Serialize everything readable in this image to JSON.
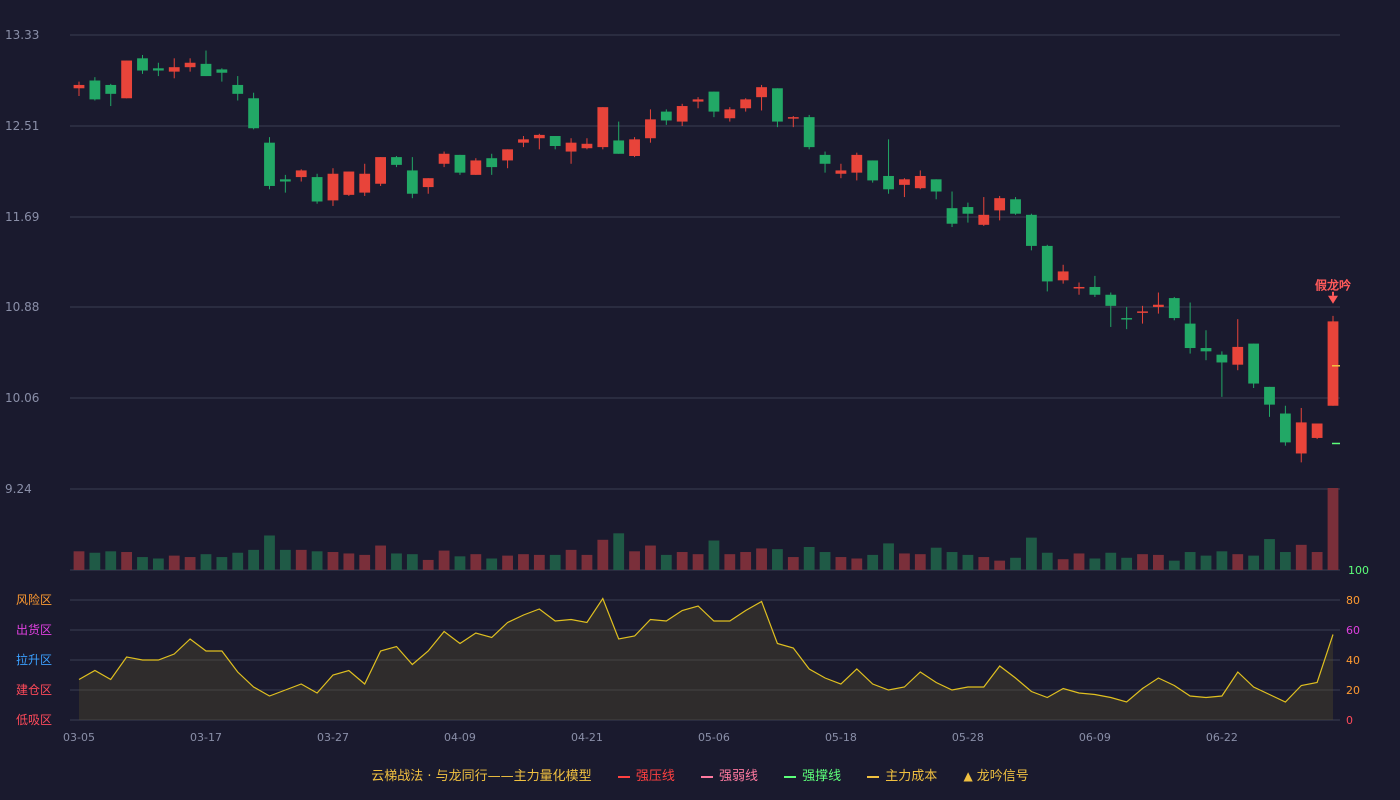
{
  "colors": {
    "background": "#1a1a2e",
    "up": "#e8443a",
    "down": "#22a866",
    "up_volume": "#7a2f3a",
    "down_volume": "#1f5a46",
    "grid": "#3a3d52",
    "axis_text": "#8a8fa8",
    "money_line": "#e0c020",
    "signal": "#ff5a5a"
  },
  "chart_data": [
    {
      "type": "candlestick",
      "title": "",
      "y_ticks": [
        9.24,
        10.06,
        10.88,
        11.69,
        12.51,
        13.33
      ],
      "ylim": [
        9.24,
        13.33
      ],
      "grid": true,
      "annotation": {
        "text": "假龙吟",
        "index": 79,
        "price": 10.9
      },
      "side_markers": [
        {
          "price": 10.35,
          "color": "#f0c040"
        },
        {
          "price": 9.65,
          "color": "#5cff7a"
        }
      ],
      "ohlc": [
        [
          12.85,
          12.88,
          12.78,
          12.91
        ],
        [
          12.92,
          12.75,
          12.74,
          12.95
        ],
        [
          12.88,
          12.8,
          12.69,
          12.89
        ],
        [
          12.76,
          13.1,
          12.76,
          13.1
        ],
        [
          13.12,
          13.01,
          12.98,
          13.15
        ],
        [
          13.03,
          13.01,
          12.96,
          13.08
        ],
        [
          13.0,
          13.04,
          12.94,
          13.12
        ],
        [
          13.04,
          13.08,
          13.0,
          13.12
        ],
        [
          13.07,
          12.96,
          12.96,
          13.19
        ],
        [
          13.02,
          12.99,
          12.91,
          13.03
        ],
        [
          12.88,
          12.8,
          12.74,
          12.96
        ],
        [
          12.76,
          12.49,
          12.48,
          12.81
        ],
        [
          12.36,
          11.97,
          11.94,
          12.41
        ],
        [
          12.03,
          12.01,
          11.91,
          12.07
        ],
        [
          12.05,
          12.11,
          12.01,
          12.12
        ],
        [
          12.05,
          11.83,
          11.81,
          12.08
        ],
        [
          11.84,
          12.08,
          11.79,
          12.13
        ],
        [
          11.89,
          12.1,
          11.88,
          12.1
        ],
        [
          11.91,
          12.08,
          11.88,
          12.17
        ],
        [
          11.99,
          12.23,
          11.97,
          12.23
        ],
        [
          12.23,
          12.16,
          12.14,
          12.24
        ],
        [
          12.11,
          11.9,
          11.86,
          12.23
        ],
        [
          11.96,
          12.04,
          11.9,
          12.04
        ],
        [
          12.17,
          12.26,
          12.14,
          12.28
        ],
        [
          12.25,
          12.09,
          12.07,
          12.25
        ],
        [
          12.07,
          12.2,
          12.07,
          12.22
        ],
        [
          12.22,
          12.14,
          12.07,
          12.26
        ],
        [
          12.2,
          12.3,
          12.13,
          12.3
        ],
        [
          12.36,
          12.39,
          12.32,
          12.42
        ],
        [
          12.4,
          12.43,
          12.3,
          12.44
        ],
        [
          12.42,
          12.33,
          12.3,
          12.42
        ],
        [
          12.28,
          12.36,
          12.17,
          12.4
        ],
        [
          12.31,
          12.35,
          12.3,
          12.4
        ],
        [
          12.32,
          12.68,
          12.3,
          12.68
        ],
        [
          12.38,
          12.26,
          12.26,
          12.55
        ],
        [
          12.24,
          12.39,
          12.23,
          12.41
        ],
        [
          12.4,
          12.57,
          12.36,
          12.66
        ],
        [
          12.64,
          12.56,
          12.52,
          12.66
        ],
        [
          12.55,
          12.69,
          12.51,
          12.71
        ],
        [
          12.73,
          12.75,
          12.67,
          12.77
        ],
        [
          12.82,
          12.64,
          12.59,
          12.82
        ],
        [
          12.58,
          12.66,
          12.55,
          12.68
        ],
        [
          12.67,
          12.75,
          12.64,
          12.76
        ],
        [
          12.77,
          12.86,
          12.65,
          12.88
        ],
        [
          12.85,
          12.55,
          12.5,
          12.85
        ],
        [
          12.59,
          12.59,
          12.5,
          12.6
        ],
        [
          12.59,
          12.32,
          12.3,
          12.61
        ],
        [
          12.25,
          12.17,
          12.09,
          12.28
        ],
        [
          12.08,
          12.11,
          12.04,
          12.17
        ],
        [
          12.09,
          12.25,
          12.02,
          12.27
        ],
        [
          12.2,
          12.02,
          12.0,
          12.2
        ],
        [
          12.06,
          11.94,
          11.9,
          12.39
        ],
        [
          11.98,
          12.03,
          11.87,
          12.04
        ],
        [
          11.95,
          12.06,
          11.94,
          12.11
        ],
        [
          12.03,
          11.92,
          11.85,
          12.03
        ],
        [
          11.77,
          11.63,
          11.6,
          11.92
        ],
        [
          11.78,
          11.72,
          11.64,
          11.82
        ],
        [
          11.62,
          11.71,
          11.61,
          11.87
        ],
        [
          11.75,
          11.86,
          11.66,
          11.88
        ],
        [
          11.85,
          11.72,
          11.71,
          11.87
        ],
        [
          11.71,
          11.43,
          11.39,
          11.72
        ],
        [
          11.43,
          11.11,
          11.02,
          11.44
        ],
        [
          11.12,
          11.2,
          11.09,
          11.26
        ],
        [
          11.06,
          11.06,
          10.99,
          11.1
        ],
        [
          11.06,
          10.99,
          10.97,
          11.16
        ],
        [
          10.99,
          10.89,
          10.7,
          11.01
        ],
        [
          10.78,
          10.77,
          10.68,
          10.88
        ],
        [
          10.83,
          10.84,
          10.73,
          10.89
        ],
        [
          10.88,
          10.9,
          10.82,
          11.01
        ],
        [
          10.96,
          10.78,
          10.76,
          10.97
        ],
        [
          10.73,
          10.51,
          10.46,
          10.92
        ],
        [
          10.51,
          10.48,
          10.4,
          10.67
        ],
        [
          10.45,
          10.38,
          10.07,
          10.48
        ],
        [
          10.36,
          10.52,
          10.31,
          10.77
        ],
        [
          10.55,
          10.19,
          10.15,
          10.55
        ],
        [
          10.16,
          10.0,
          9.89,
          10.16
        ],
        [
          9.92,
          9.66,
          9.63,
          9.99
        ],
        [
          9.56,
          9.84,
          9.48,
          9.97
        ],
        [
          9.7,
          9.83,
          9.69,
          9.82
        ],
        [
          9.99,
          10.75,
          9.99,
          10.8
        ]
      ],
      "volume": [
        26,
        24,
        26,
        25,
        18,
        16,
        20,
        18,
        22,
        18,
        24,
        28,
        48,
        28,
        28,
        26,
        25,
        23,
        21,
        34,
        23,
        22,
        14,
        27,
        19,
        22,
        16,
        20,
        22,
        21,
        21,
        28,
        21,
        42,
        51,
        26,
        34,
        21,
        25,
        22,
        41,
        22,
        25,
        30,
        29,
        18,
        32,
        25,
        18,
        16,
        21,
        37,
        23,
        22,
        31,
        25,
        21,
        18,
        13,
        17,
        45,
        24,
        15,
        23,
        16,
        24,
        17,
        22,
        21,
        13,
        25,
        20,
        26,
        22,
        20,
        43,
        25,
        35,
        25,
        114
      ],
      "volume_axis_max_label": "100"
    },
    {
      "type": "area",
      "title": "",
      "values": [
        27,
        33,
        27,
        42,
        40,
        40,
        44,
        54,
        46,
        46,
        32,
        22,
        16,
        20,
        24,
        18,
        30,
        33,
        24,
        46,
        49,
        37,
        46,
        59,
        51,
        58,
        55,
        65,
        70,
        74,
        66,
        67,
        65,
        81,
        54,
        56,
        67,
        66,
        73,
        76,
        66,
        66,
        73,
        79,
        51,
        48,
        34,
        28,
        24,
        34,
        24,
        20,
        22,
        32,
        25,
        20,
        22,
        22,
        36,
        28,
        19,
        15,
        21,
        18,
        17,
        15,
        12,
        21,
        28,
        23,
        16,
        15,
        16,
        32,
        22,
        17,
        12,
        23,
        25,
        57
      ],
      "ylim": [
        0,
        80
      ],
      "y_ticks": [
        0,
        20,
        40,
        60,
        80
      ],
      "zone_labels": [
        {
          "text": "低吸区",
          "color": "#ff4a5a"
        },
        {
          "text": "建仓区",
          "color": "#ff4a5a"
        },
        {
          "text": "拉升区",
          "color": "#3aa0ff"
        },
        {
          "text": "出货区",
          "color": "#e040e0"
        },
        {
          "text": "风险区",
          "color": "#ff9a30"
        }
      ],
      "tick_colors": [
        "#ff4a5a",
        "#ff9a30",
        "#ff9a30",
        "#e040e0",
        "#ff9a30"
      ]
    }
  ],
  "x_axis": {
    "labels": [
      "03-05",
      "03-17",
      "03-27",
      "04-09",
      "04-21",
      "05-06",
      "05-18",
      "05-28",
      "06-09",
      "06-22"
    ],
    "label_indices": [
      0,
      8,
      16,
      24,
      32,
      40,
      48,
      56,
      64,
      72
    ]
  },
  "legend": {
    "title": "云梯战法 · 与龙同行——主力量化模型",
    "items": [
      {
        "label": "强压线",
        "color": "#ff4040",
        "style": "solid"
      },
      {
        "label": "强弱线",
        "color": "#ff7aa0",
        "style": "dash"
      },
      {
        "label": "强撑线",
        "color": "#5cff7a",
        "style": "solid"
      },
      {
        "label": "主力成本",
        "color": "#f0c040",
        "style": "dash"
      },
      {
        "label": "龙吟信号",
        "color": "#f0c040",
        "style": "triangle"
      }
    ]
  }
}
